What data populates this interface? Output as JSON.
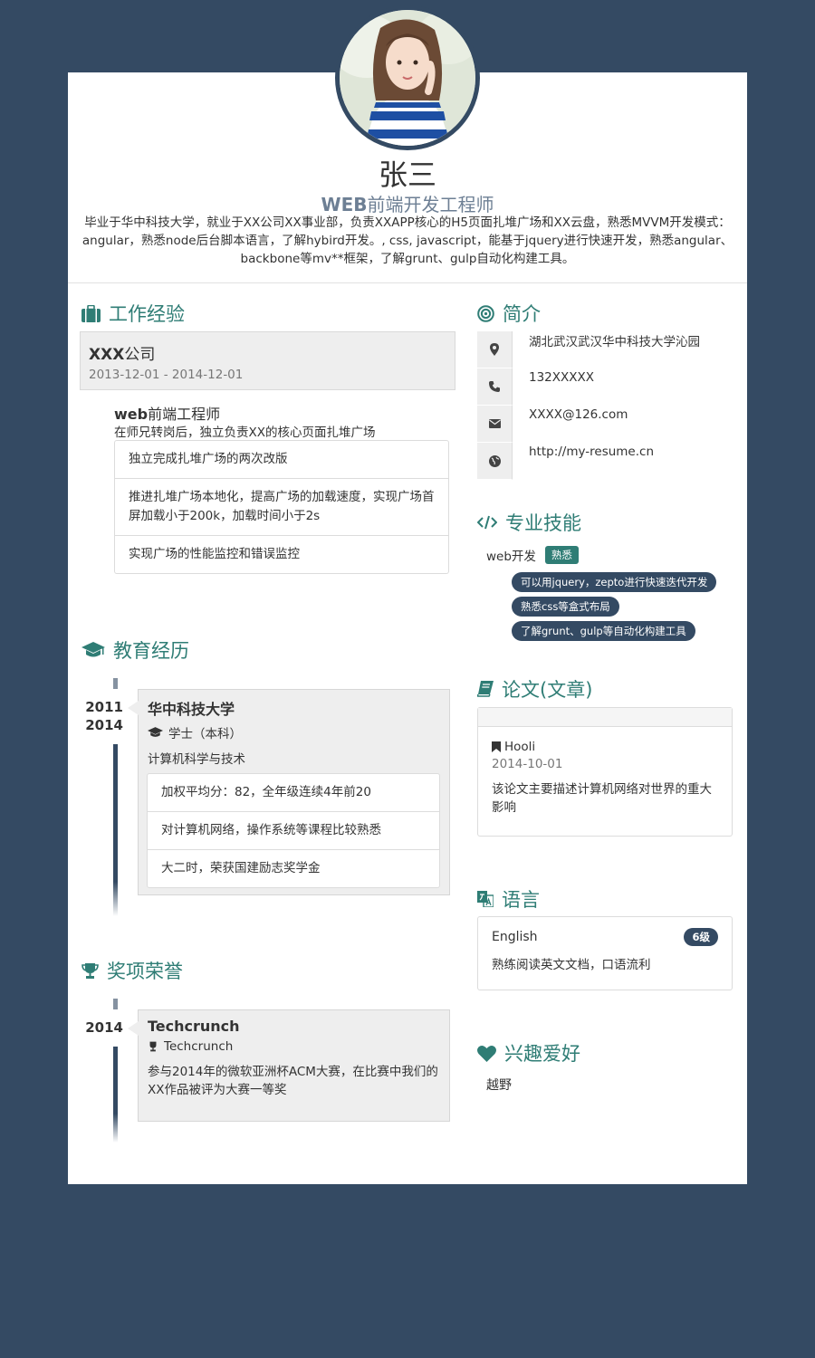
{
  "header": {
    "name": "张三",
    "role_bold": "WEB",
    "role_rest": "前端开发工程师",
    "summary": "毕业于华中科技大学，就业于XX公司XX事业部，负责XXAPP核心的H5页面扎堆广场和XX云盘，熟悉MVVM开发模式：angular，熟悉node后台脚本语言，了解hybird开发。, css, javascript，能基于jquery进行快速开发，熟悉angular、backbone等mv**框架，了解grunt、gulp自动化构建工具。"
  },
  "work": {
    "title": "工作经验",
    "company_bold": "XXX",
    "company_rest": "公司",
    "date": "2013-12-01 - 2014-12-01",
    "job_bold": "web",
    "job_rest": "前端工程师",
    "job_desc": "在师兄转岗后，独立负责XX的核心页面扎堆广场",
    "items": [
      "独立完成扎堆广场的两次改版",
      "推进扎堆广场本地化，提高广场的加载速度，实现广场首屏加载小于200k，加载时间小于2s",
      "实现广场的性能监控和错误监控"
    ]
  },
  "education": {
    "title": "教育经历",
    "year_start": "2011",
    "year_end": "2014",
    "school": "华中科技大学",
    "degree": "学士（本科）",
    "major": "计算机科学与技术",
    "items": [
      "加权平均分：82，全年级连续4年前20",
      "对计算机网络，操作系统等课程比较熟悉",
      "大二时，荣获国建励志奖学金"
    ]
  },
  "awards": {
    "title": "奖项荣誉",
    "year": "2014",
    "name": "Techcrunch",
    "sub": "Techcrunch",
    "desc": "参与2014年的微软亚洲杯ACM大赛，在比赛中我们的XX作品被评为大赛一等奖"
  },
  "intro": {
    "title": "简介",
    "address": "湖北武汉武汉华中科技大学沁园",
    "phone": "132XXXXX",
    "email": "XXXX@126.com",
    "website": "http://my-resume.cn"
  },
  "skills": {
    "title": "专业技能",
    "name": "web开发",
    "level": "熟悉",
    "tags": [
      "可以用jquery，zepto进行快速迭代开发",
      "熟悉css等盒式布局",
      "了解grunt、gulp等自动化构建工具"
    ]
  },
  "papers": {
    "title": "论文(文章)",
    "name": "Hooli",
    "date": "2014-10-01",
    "desc": "该论文主要描述计算机网络对世界的重大影响"
  },
  "language": {
    "title": "语言",
    "name": "English",
    "level": "6级",
    "desc": "熟练阅读英文文档，口语流利"
  },
  "hobbies": {
    "title": "兴趣爱好",
    "item": "越野"
  },
  "colors": {
    "background": "#344a63",
    "accent": "#2f7d75",
    "card": "#eeeeee"
  }
}
